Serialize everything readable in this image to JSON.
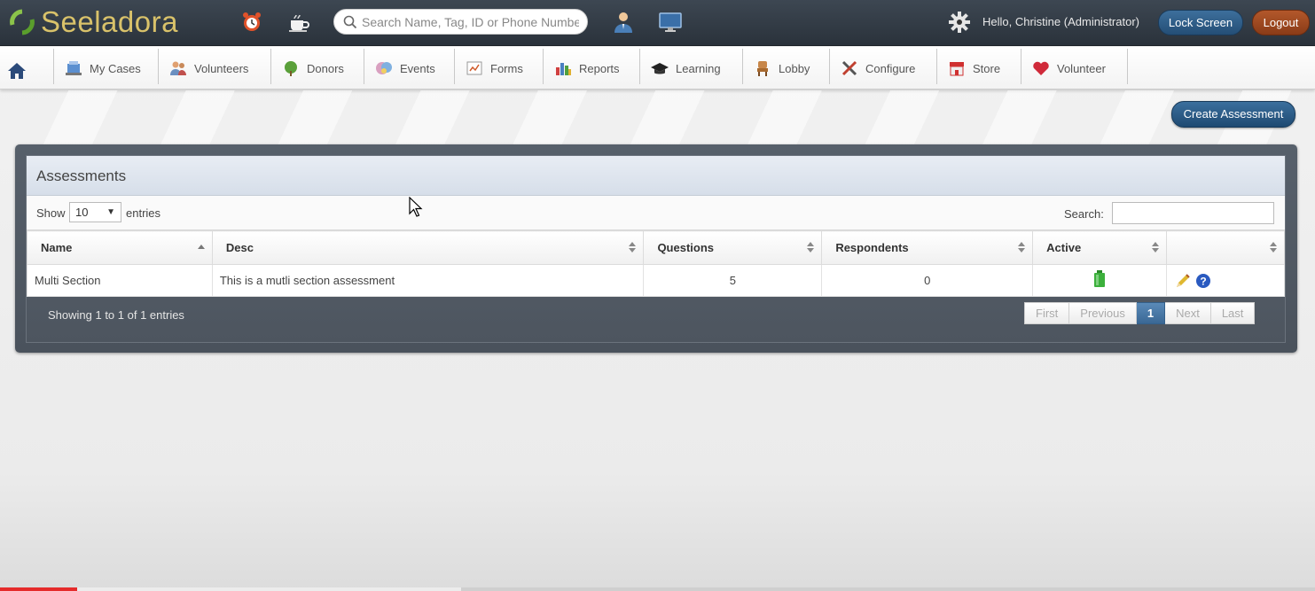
{
  "app": {
    "logo_text": "Seeladora",
    "search_placeholder": "Search Name, Tag, ID or Phone Number",
    "greeting": "Hello, Christine (Administrator)",
    "lock_label": "Lock Screen",
    "logout_label": "Logout"
  },
  "nav": {
    "items": [
      {
        "label": "My Cases",
        "icon": "cases-icon"
      },
      {
        "label": "Volunteers",
        "icon": "volunteers-icon"
      },
      {
        "label": "Donors",
        "icon": "donors-icon"
      },
      {
        "label": "Events",
        "icon": "events-icon"
      },
      {
        "label": "Forms",
        "icon": "forms-icon"
      },
      {
        "label": "Reports",
        "icon": "reports-icon"
      },
      {
        "label": "Learning",
        "icon": "learning-icon"
      },
      {
        "label": "Lobby",
        "icon": "lobby-icon"
      },
      {
        "label": "Configure",
        "icon": "configure-icon"
      },
      {
        "label": "Store",
        "icon": "store-icon"
      },
      {
        "label": "Volunteer",
        "icon": "volunteer-heart-icon"
      }
    ]
  },
  "page": {
    "create_label": "Create Assessment",
    "panel_title": "Assessments",
    "show_label": "Show",
    "entries_value": "10",
    "entries_label": "entries",
    "search_label": "Search:"
  },
  "table": {
    "columns": [
      "Name",
      "Desc",
      "Questions",
      "Respondents",
      "Active",
      ""
    ],
    "rows": [
      {
        "name": "Multi Section",
        "desc": "This is a mutli section assessment",
        "questions": "5",
        "respondents": "0",
        "active": true
      }
    ]
  },
  "footer": {
    "info": "Showing 1 to 1 of 1 entries",
    "pager": [
      "First",
      "Previous",
      "1",
      "Next",
      "Last"
    ]
  },
  "colors": {
    "topbar": "#2f3841",
    "accent_blue": "#2b5a86",
    "logout_red": "#a04a22",
    "logo_gold": "#d9c26a"
  }
}
